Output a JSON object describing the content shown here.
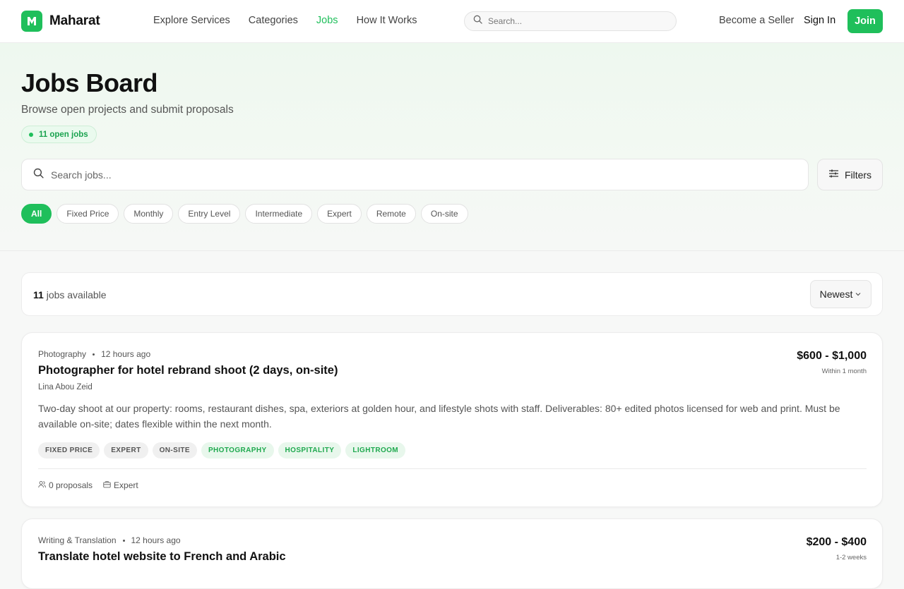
{
  "brand": {
    "name": "Maharat",
    "logo_letter": "M",
    "accent": "#1fbf5b"
  },
  "nav": {
    "links": [
      {
        "label": "Explore Services",
        "active": false
      },
      {
        "label": "Categories",
        "active": false
      },
      {
        "label": "Jobs",
        "active": true
      },
      {
        "label": "How It Works",
        "active": false
      }
    ],
    "search_placeholder": "Search...",
    "become_seller": "Become a Seller",
    "sign_in": "Sign In",
    "join": "Join"
  },
  "hero": {
    "title": "Jobs Board",
    "subtitle": "Browse open projects and submit proposals",
    "open_jobs_badge": "11 open jobs",
    "search_placeholder": "Search jobs...",
    "filters_label": "Filters",
    "chips": [
      {
        "label": "All",
        "active": true
      },
      {
        "label": "Fixed Price",
        "active": false
      },
      {
        "label": "Monthly",
        "active": false
      },
      {
        "label": "Entry Level",
        "active": false
      },
      {
        "label": "Intermediate",
        "active": false
      },
      {
        "label": "Expert",
        "active": false
      },
      {
        "label": "Remote",
        "active": false
      },
      {
        "label": "On-site",
        "active": false
      }
    ]
  },
  "results": {
    "count": "11",
    "count_suffix": "jobs available",
    "sort_label": "Newest"
  },
  "jobs": [
    {
      "category": "Photography",
      "posted": "12 hours ago",
      "title": "Photographer for hotel rebrand shoot (2 days, on-site)",
      "client": "Lina Abou Zeid",
      "price": "$600 - $1,000",
      "timeline": "Within 1 month",
      "description": "Two-day shoot at our property: rooms, restaurant dishes, spa, exteriors at golden hour, and lifestyle shots with staff. Deliverables: 80+ edited photos licensed for web and print. Must be available on-site; dates flexible within the next month.",
      "tags": [
        "FIXED PRICE",
        "EXPERT",
        "ON-SITE"
      ],
      "skills": [
        "PHOTOGRAPHY",
        "HOSPITALITY",
        "LIGHTROOM"
      ],
      "proposals": "0 proposals",
      "level": "Expert"
    },
    {
      "category": "Writing & Translation",
      "posted": "12 hours ago",
      "title": "Translate hotel website to French and Arabic",
      "price": "$200 - $400",
      "timeline": "1-2 weeks"
    }
  ]
}
